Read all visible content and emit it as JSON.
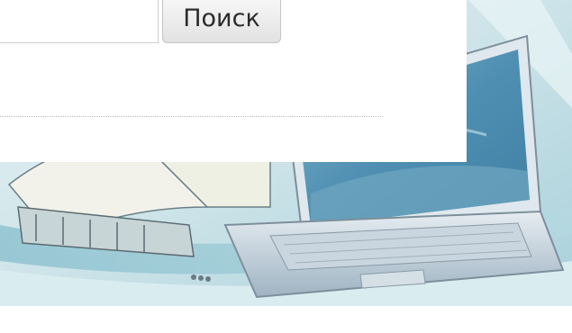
{
  "search": {
    "button_label": "Поиск",
    "input_value": "",
    "input_placeholder": ""
  },
  "banner": {
    "image_name": "laptop-and-book-illustration"
  },
  "colors": {
    "banner_sky": "#cfe6ec",
    "banner_teal": "#8cc2cf",
    "screen_blue": "#4d8fb3",
    "button_gray": "#e9e9e9"
  }
}
